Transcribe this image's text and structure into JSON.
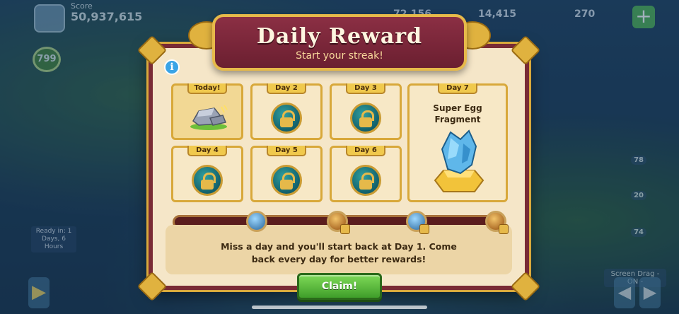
{
  "hud": {
    "score_label": "Score",
    "score_value": "50,937,615",
    "stat_1": "72,156",
    "stat_2": "14,415",
    "stat_3": "270",
    "level": "799",
    "ready_text": "Ready in: 1 Days, 6 Hours",
    "screen_drag": "Screen Drag - ON -",
    "badge_counts": [
      "78",
      "20",
      "74"
    ]
  },
  "dialog": {
    "title": "Daily Reward",
    "subtitle": "Start your streak!",
    "days": [
      {
        "label": "Today!",
        "state": "current"
      },
      {
        "label": "Day 2",
        "state": "locked"
      },
      {
        "label": "Day 3",
        "state": "locked"
      },
      {
        "label": "Day 4",
        "state": "locked"
      },
      {
        "label": "Day 5",
        "state": "locked"
      },
      {
        "label": "Day 6",
        "state": "locked"
      }
    ],
    "day7": {
      "label": "Day 7",
      "reward": "Super Egg Fragment"
    },
    "message": "Miss a day and you'll start back at Day 1. Come back every day for better rewards!",
    "claim_label": "Claim!"
  },
  "colors": {
    "banner": "#7a2b35",
    "panel": "#f5e6c8",
    "gold": "#e0b23f",
    "claim_green": "#4caf50"
  }
}
